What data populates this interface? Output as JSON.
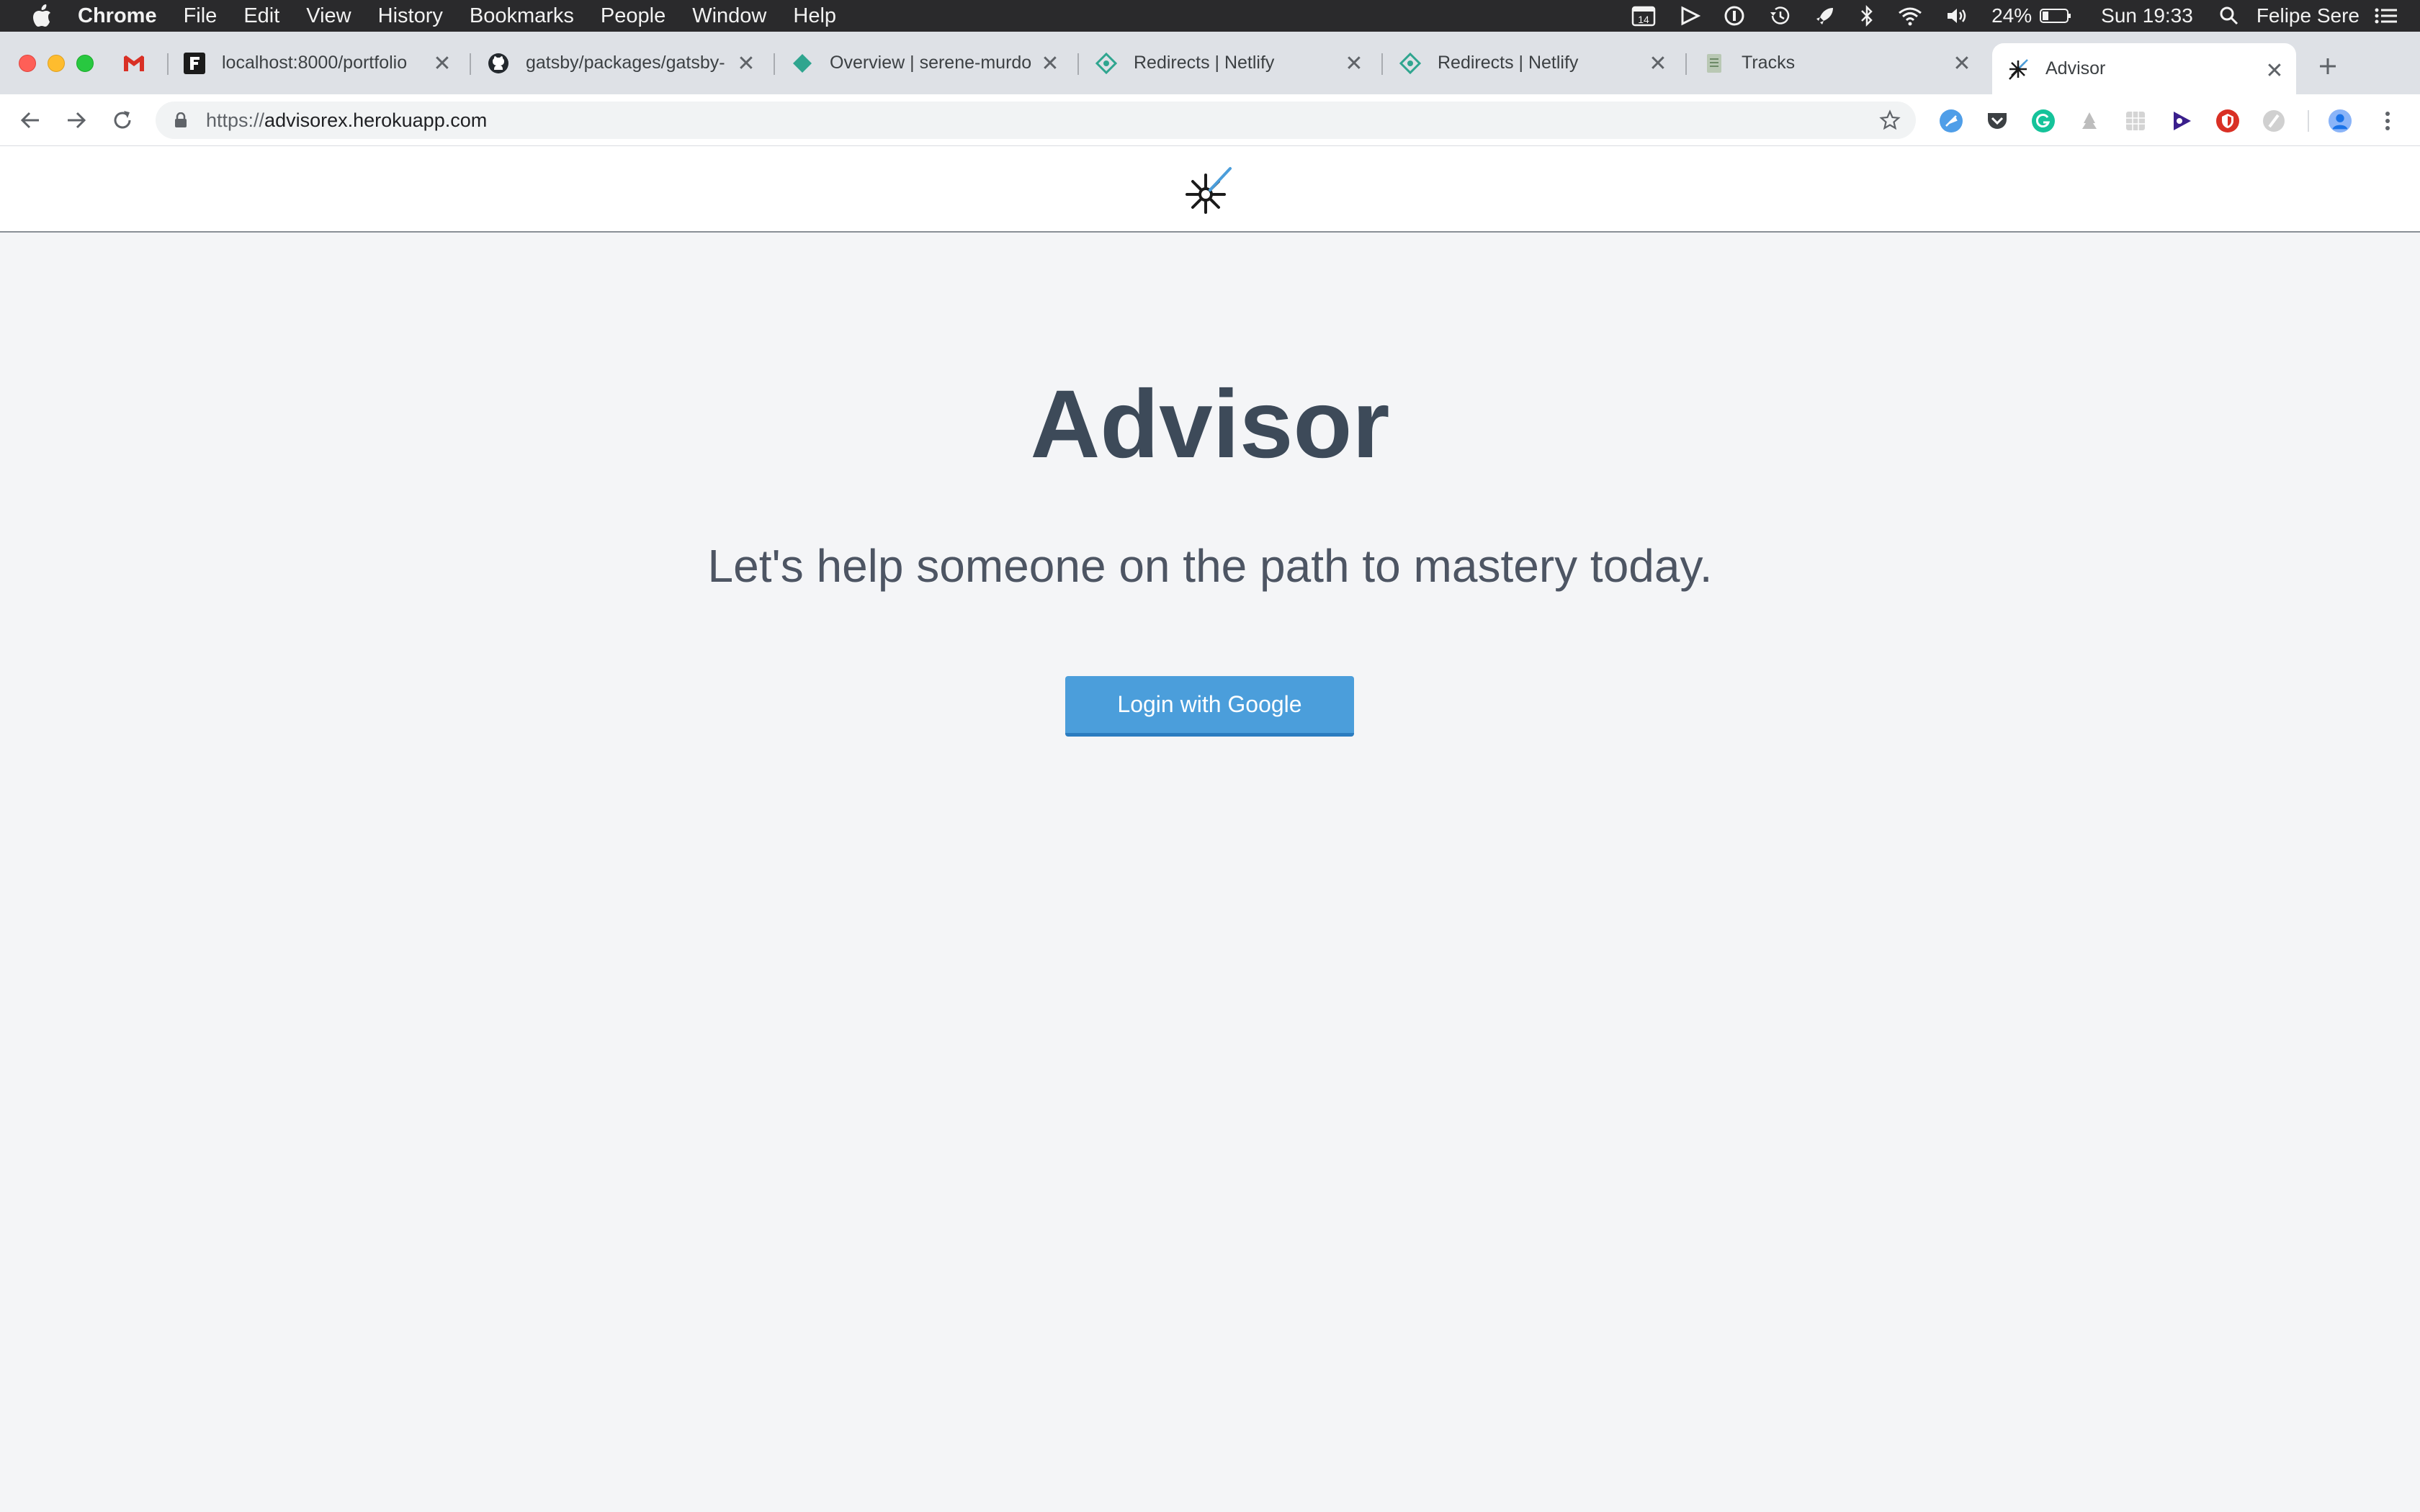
{
  "menubar": {
    "app_name": "Chrome",
    "items": [
      "File",
      "Edit",
      "View",
      "History",
      "Bookmarks",
      "People",
      "Window",
      "Help"
    ],
    "status": {
      "calendar_date": "14",
      "battery": "24%",
      "clock": "Sun 19:33",
      "user": "Felipe Sere"
    }
  },
  "tabs": [
    {
      "title": "",
      "icon": "gmail-icon"
    },
    {
      "title": "localhost:8000/portfolio",
      "icon": "f-logo-icon"
    },
    {
      "title": "gatsby/packages/gatsby-",
      "icon": "github-icon"
    },
    {
      "title": "Overview | serene-murdo",
      "icon": "netlify-diamond-icon"
    },
    {
      "title": "Redirects | Netlify",
      "icon": "netlify-icon"
    },
    {
      "title": "Redirects | Netlify",
      "icon": "netlify-icon"
    },
    {
      "title": "Tracks",
      "icon": "sheet-icon"
    },
    {
      "title": "Advisor",
      "icon": "advisor-logo-icon",
      "active": true
    }
  ],
  "toolbar": {
    "url_scheme": "https://",
    "url_host": "advisorex.herokuapp.com"
  },
  "page": {
    "title": "Advisor",
    "subtitle": "Let's help someone on the path to mastery today.",
    "login_label": "Login with Google"
  },
  "colors": {
    "accent": "#4b9edb",
    "title": "#3d4a59",
    "background": "#f4f5f7"
  }
}
